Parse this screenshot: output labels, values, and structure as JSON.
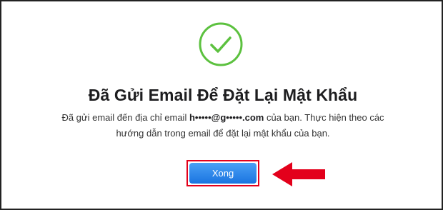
{
  "dialog": {
    "title": "Đã Gửi Email Để Đặt Lại Mật Khẩu",
    "message_prefix": "Đã gửi email đến địa chỉ email ",
    "email": "h•••••@g•••••.com",
    "message_suffix_line1": " của bạn. Thực hiện theo các",
    "message_line2": "hướng dẫn trong email để đặt lại mật khẩu của bạn.",
    "done_button_label": "Xong"
  },
  "icons": {
    "status_icon": "checkmark-circle-icon",
    "annotation_icon": "red-arrow-left-icon"
  },
  "colors": {
    "check_green": "#5cc13f",
    "button_blue": "#1a74e0",
    "highlight_red": "#e3001b"
  }
}
